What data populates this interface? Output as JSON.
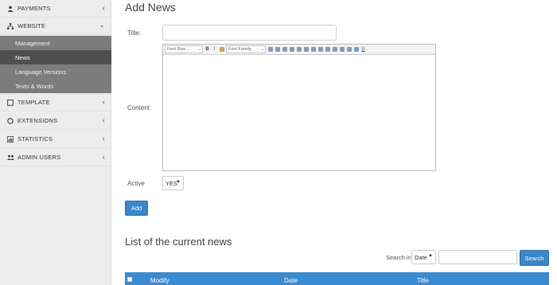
{
  "sidebar": {
    "items": [
      {
        "label": "PAYMENTS",
        "icon": "user-icon"
      },
      {
        "label": "WEBSITE",
        "icon": "sitemap-icon"
      },
      {
        "label": "TEMPLATE",
        "icon": "template-icon"
      },
      {
        "label": "EXTENSIONS",
        "icon": "circle-icon"
      },
      {
        "label": "STATISTICS",
        "icon": "chart-icon"
      },
      {
        "label": "ADMIN USERS",
        "icon": "users-icon"
      }
    ],
    "website_submenu": [
      {
        "label": "Management"
      },
      {
        "label": "News"
      },
      {
        "label": "Language Versions"
      },
      {
        "label": "Texts & Words"
      }
    ]
  },
  "form": {
    "page_title": "Add News",
    "title_label": "Title:",
    "title_value": "",
    "content_label": "Content:",
    "active_label": "Active",
    "active_value": "YES",
    "add_button": "Add",
    "toolbar": {
      "font_size": "Font Size...",
      "font_family": "Font Family",
      "bold": "B",
      "italic": "I",
      "underline": "U"
    }
  },
  "list": {
    "title": "List of the current news",
    "search_in_label": "Search in",
    "search_field": "Date",
    "search_value": "",
    "search_button": "Search",
    "columns": [
      "Modify",
      "Date",
      "Title"
    ]
  },
  "colors": {
    "accent": "#3a87c8",
    "table_header": "#3b8ad2",
    "submenu": "#7c7c7c",
    "submenu_active": "#4f4f4f"
  }
}
